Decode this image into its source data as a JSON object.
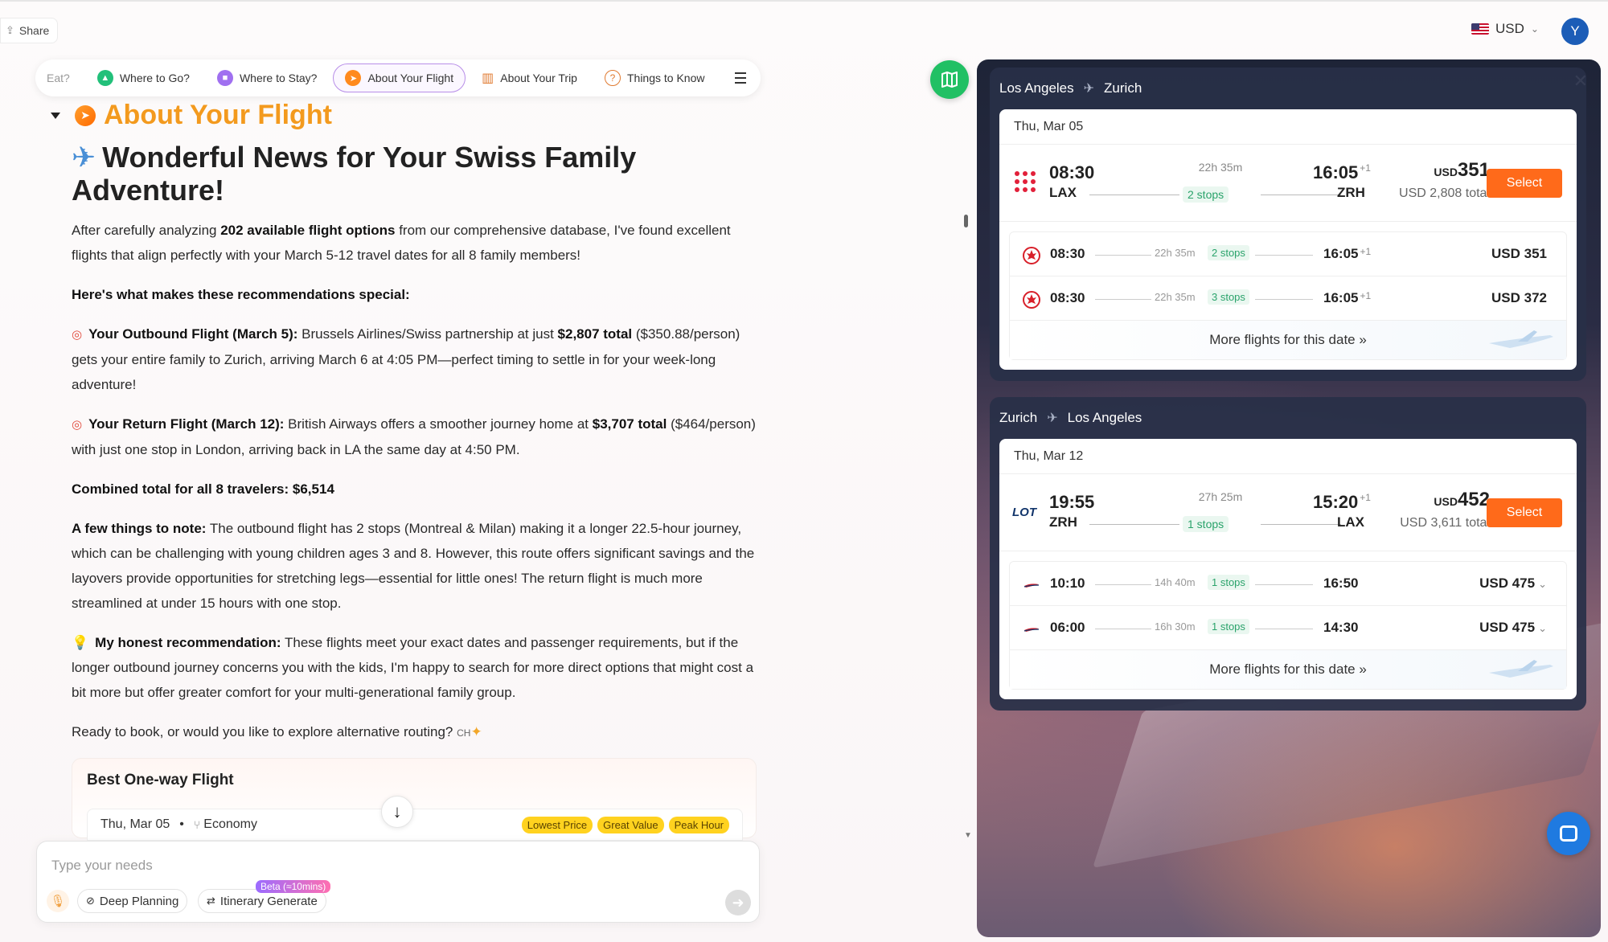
{
  "topbar": {
    "share_label": "Share",
    "currency": "USD",
    "avatar_initial": "Y"
  },
  "tabs": [
    {
      "label": "Eat?",
      "icon": "partial"
    },
    {
      "label": "Where to Go?",
      "icon": "compass-icon"
    },
    {
      "label": "Where to Stay?",
      "icon": "hotel-icon"
    },
    {
      "label": "About Your Flight",
      "icon": "flight-icon",
      "active": true
    },
    {
      "label": "About Your Trip",
      "icon": "map-icon"
    },
    {
      "label": "Things to Know",
      "icon": "question-icon"
    }
  ],
  "chat": {
    "section_title": "About Your Flight",
    "headline": "Wonderful News for Your Swiss Family Adventure!",
    "intro_pre": "After carefully analyzing ",
    "intro_bold": "202 available flight options",
    "intro_post": " from our comprehensive database, I've found excellent flights that align perfectly with your March 5-12 travel dates for all 8 family members!",
    "special_heading": "Here's what makes these recommendations special:",
    "outbound_bold": "Your Outbound Flight (March 5):",
    "outbound_text1": " Brussels Airlines/Swiss partnership at just ",
    "outbound_price_bold": "$2,807 total",
    "outbound_text2": " ($350.88/person) gets your entire family to Zurich, arriving March 6 at 4:05 PM—perfect timing to settle in for your week-long adventure!",
    "return_bold": "Your Return Flight (March 12):",
    "return_text1": " British Airways offers a smoother journey home at ",
    "return_price_bold": "$3,707 total",
    "return_text2": " ($464/person) with just one stop in London, arriving back in LA the same day at 4:50 PM.",
    "combined": "Combined total for all 8 travelers: $6,514",
    "note_bold": "A few things to note:",
    "note_text": " The outbound flight has 2 stops (Montreal & Milan) making it a longer 22.5-hour journey, which can be challenging with young children ages 3 and 8. However, this route offers significant savings and the layovers provide opportunities for stretching legs—essential for little ones! The return flight is much more streamlined at under 15 hours with one stop.",
    "rec_bold": "My honest recommendation:",
    "rec_text": " These flights meet your exact dates and passenger requirements, but if the longer outbound journey concerns you with the kids, I'm happy to search for more direct options that might cost a bit more but offer greater comfort for your multi-generational family group.",
    "closing": "Ready to book, or would you like to explore alternative routing?",
    "closing_tag": "CH"
  },
  "best_card": {
    "title": "Best One-way Flight",
    "date": "Thu, Mar 05",
    "cabin": "Economy",
    "chips": [
      "Lowest Price",
      "Great Value",
      "Peak Hour"
    ]
  },
  "input": {
    "placeholder": "Type your needs",
    "deep_planning": "Deep Planning",
    "itinerary": "Itinerary Generate",
    "beta": "Beta (≈10mins)"
  },
  "flights": {
    "outbound": {
      "from": "Los Angeles",
      "to": "Zurich",
      "date": "Thu, Mar 05",
      "main": {
        "dep_time": "08:30",
        "dep_code": "LAX",
        "duration": "22h 35m",
        "stops": "2 stops",
        "arr_time": "16:05",
        "arr_plus": "+1",
        "arr_code": "ZRH",
        "price_cur": "USD",
        "price": "351",
        "total": "USD 2,808 total",
        "select": "Select"
      },
      "alts": [
        {
          "dep": "08:30",
          "dur": "22h 35m",
          "stops": "2 stops",
          "arr": "16:05",
          "plus": "+1",
          "price": "USD 351",
          "chev": ""
        },
        {
          "dep": "08:30",
          "dur": "22h 35m",
          "stops": "3 stops",
          "arr": "16:05",
          "plus": "+1",
          "price": "USD 372",
          "chev": ""
        }
      ],
      "more": "More flights for this date »"
    },
    "return": {
      "from": "Zurich",
      "to": "Los Angeles",
      "date": "Thu, Mar 12",
      "main": {
        "dep_time": "19:55",
        "dep_code": "ZRH",
        "duration": "27h 25m",
        "stops": "1 stops",
        "arr_time": "15:20",
        "arr_plus": "+1",
        "arr_code": "LAX",
        "price_cur": "USD",
        "price": "452",
        "total": "USD 3,611 total",
        "select": "Select"
      },
      "alts": [
        {
          "dep": "10:10",
          "dur": "14h 40m",
          "stops": "1 stops",
          "arr": "16:50",
          "plus": "",
          "price": "USD 475",
          "chev": "⌄"
        },
        {
          "dep": "06:00",
          "dur": "16h 30m",
          "stops": "1 stops",
          "arr": "14:30",
          "plus": "",
          "price": "USD 475",
          "chev": "⌄"
        }
      ],
      "more": "More flights for this date »"
    }
  },
  "colors": {
    "accent_orange": "#ff6a1a",
    "title_orange": "#f39a1e",
    "stops_green": "#2aa36b",
    "map_green": "#21c064",
    "chip_yellow": "#ffd21f"
  }
}
